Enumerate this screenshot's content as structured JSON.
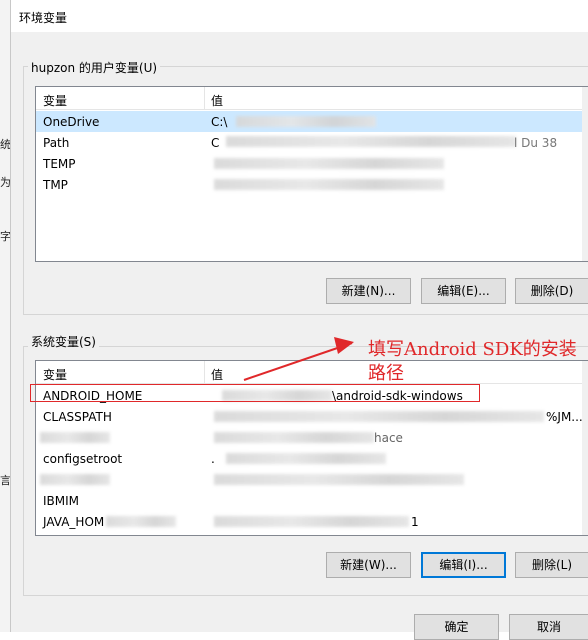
{
  "window": {
    "title": "环境变量"
  },
  "background_fragments": [
    "统",
    "为",
    "字",
    "言"
  ],
  "user_vars": {
    "group_label": "hupzon 的用户变量(U)",
    "columns": {
      "name": "变量",
      "value": "值"
    },
    "rows": [
      {
        "name": "OneDrive",
        "value": "C:\\"
      },
      {
        "name": "Path",
        "value": "C",
        "value_tail": "l Du        38"
      },
      {
        "name": "TEMP",
        "value": ""
      },
      {
        "name": "TMP",
        "value": ""
      }
    ],
    "buttons": {
      "new": "新建(N)...",
      "edit": "编辑(E)...",
      "delete": "删除(D)"
    }
  },
  "system_vars": {
    "group_label": "系统变量(S)",
    "columns": {
      "name": "变量",
      "value": "值"
    },
    "rows": [
      {
        "name": "ANDROID_HOME",
        "value": "\\android-sdk-windows"
      },
      {
        "name": "CLASSPATH",
        "value": "",
        "value_tail": "%JM..."
      },
      {
        "name": "",
        "value": "",
        "value_tail": "hace"
      },
      {
        "name": "configsetroot",
        "value": "."
      },
      {
        "name": "",
        "value": ""
      },
      {
        "name": "IBMIM",
        "value": ""
      },
      {
        "name": "JAVA_HOM",
        "value": "",
        "value_tail": "1"
      }
    ],
    "buttons": {
      "new": "新建(W)...",
      "edit": "编辑(I)...",
      "delete": "删除(L)"
    }
  },
  "footer": {
    "ok": "确定",
    "cancel": "取消"
  },
  "annotation": {
    "text": "填写Android SDK的安装路径",
    "color": "#e0282a"
  }
}
